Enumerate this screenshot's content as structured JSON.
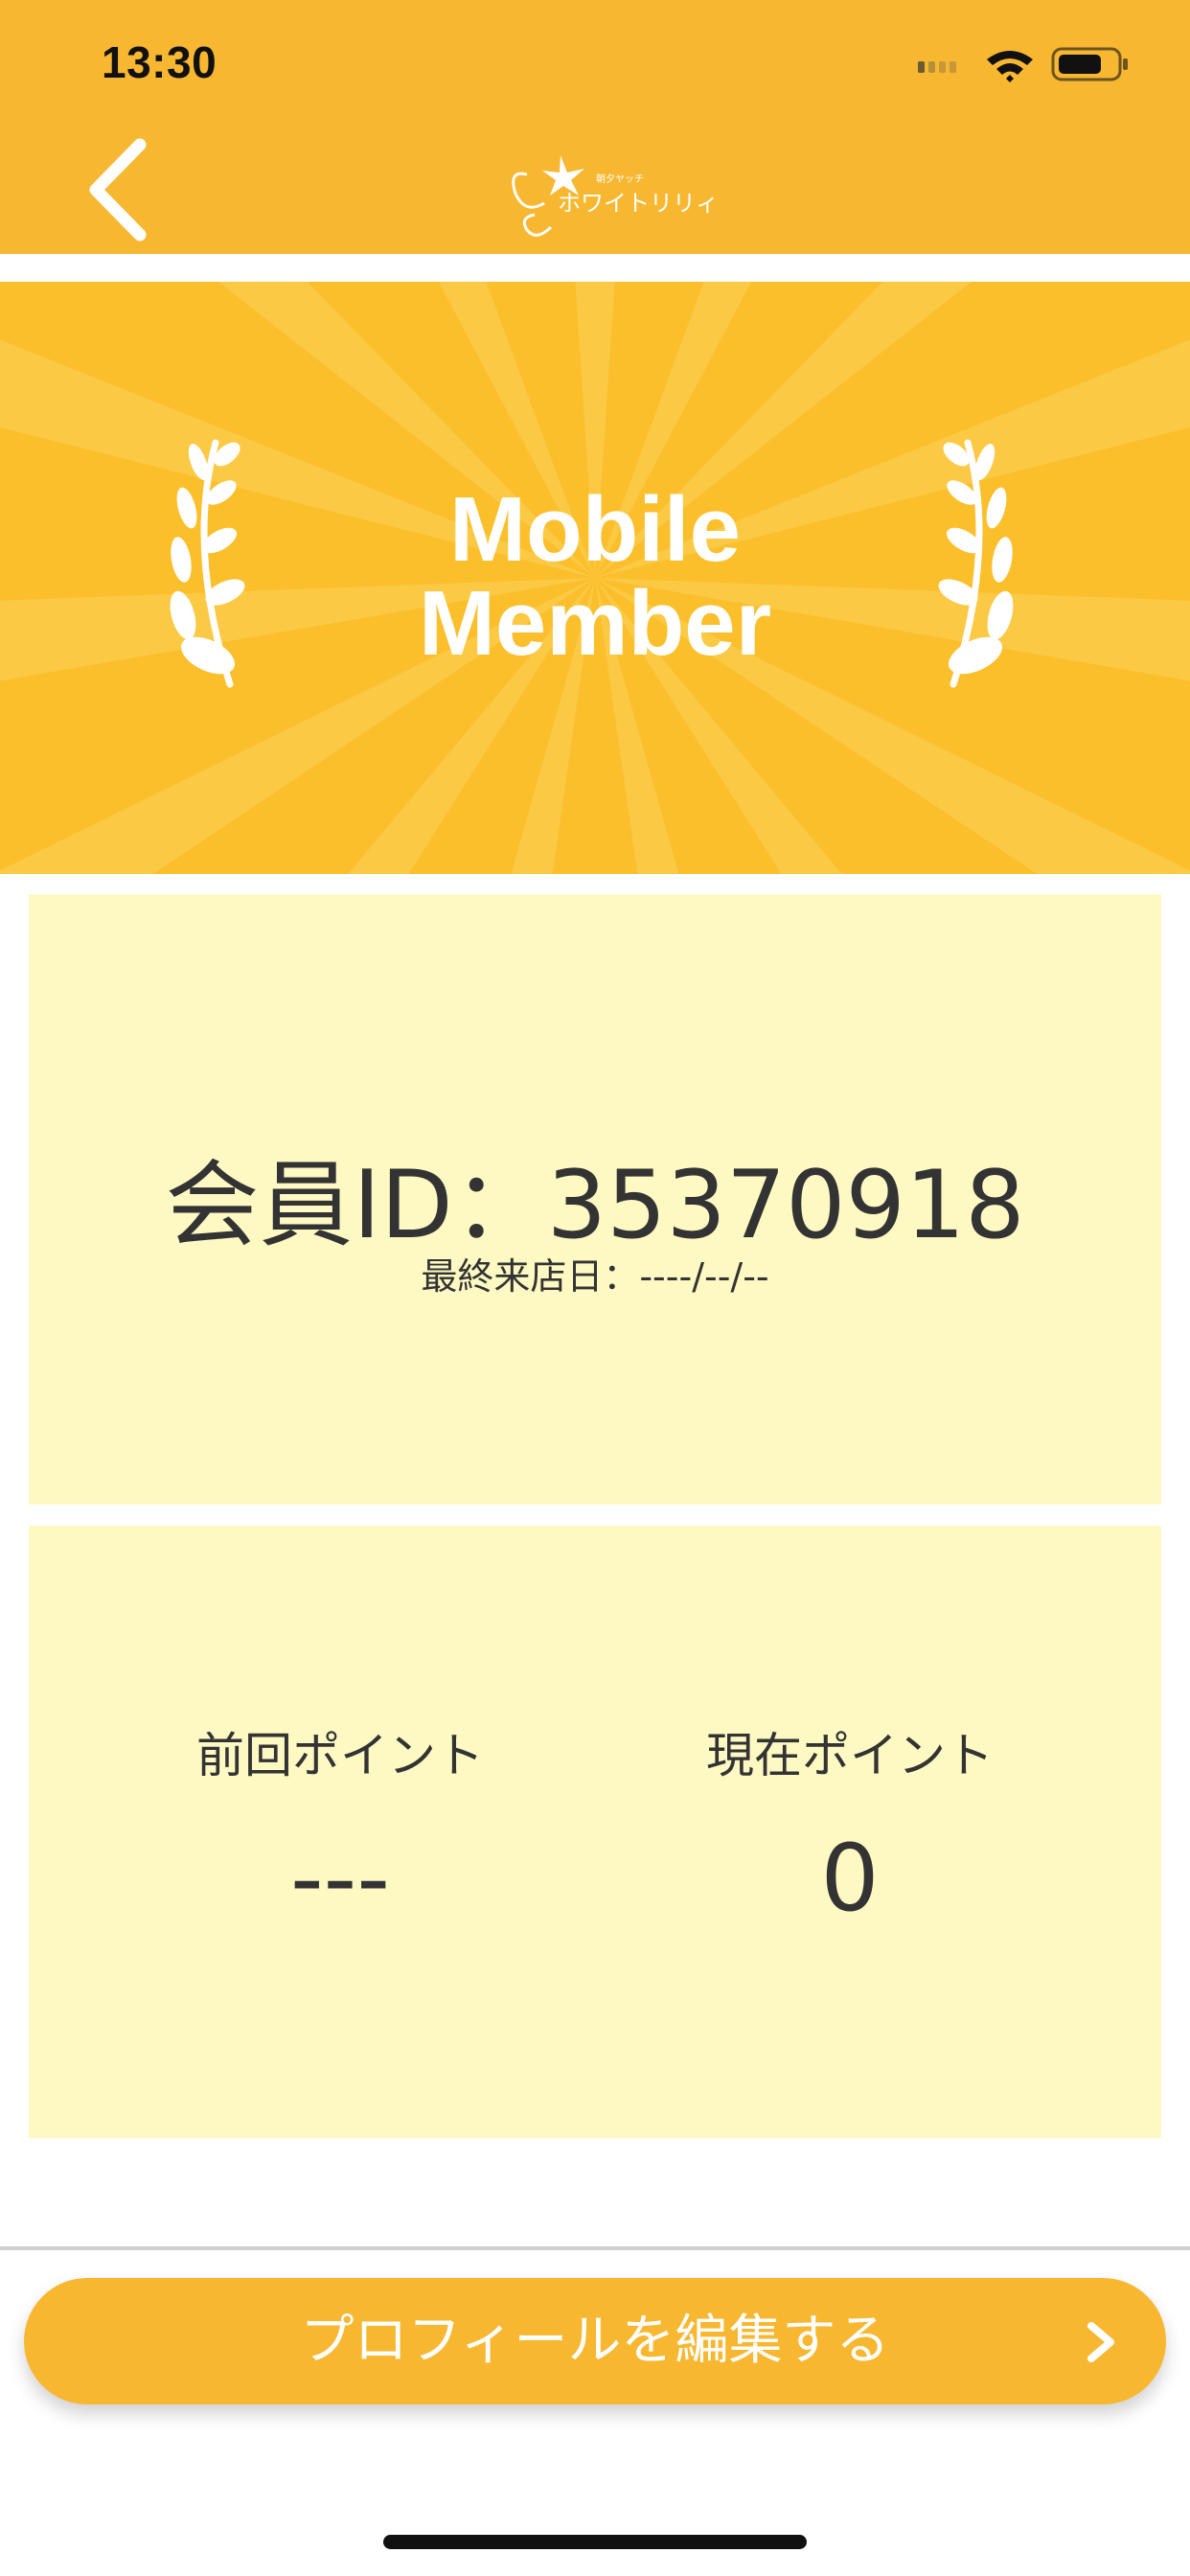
{
  "status_bar": {
    "time": "13:30",
    "icons": [
      "signal-icon",
      "wifi-icon",
      "battery-icon"
    ]
  },
  "nav": {
    "back_icon": "chevron-left-icon",
    "logo_text": "ホワイトリリィ",
    "logo_small_text": "朝夕ヤッチ"
  },
  "banner": {
    "title_line1": "Mobile",
    "title_line2": "Member",
    "decoration_icon": "laurel-icon"
  },
  "member_card": {
    "member_id_text": "会員ID：35370918",
    "last_visit_text": "最終来店日：----/--/--"
  },
  "points_card": {
    "previous_label": "前回ポイント",
    "previous_value": "---",
    "current_label": "現在ポイント",
    "current_value": "0"
  },
  "edit_profile": {
    "label": "プロフィールを編集する",
    "chevron_icon": "chevron-right-icon"
  },
  "colors": {
    "header": "#f8b731",
    "banner": "#fbbf2c",
    "card_bg": "#fef9c3",
    "text": "#333333",
    "button": "#f8b731"
  }
}
